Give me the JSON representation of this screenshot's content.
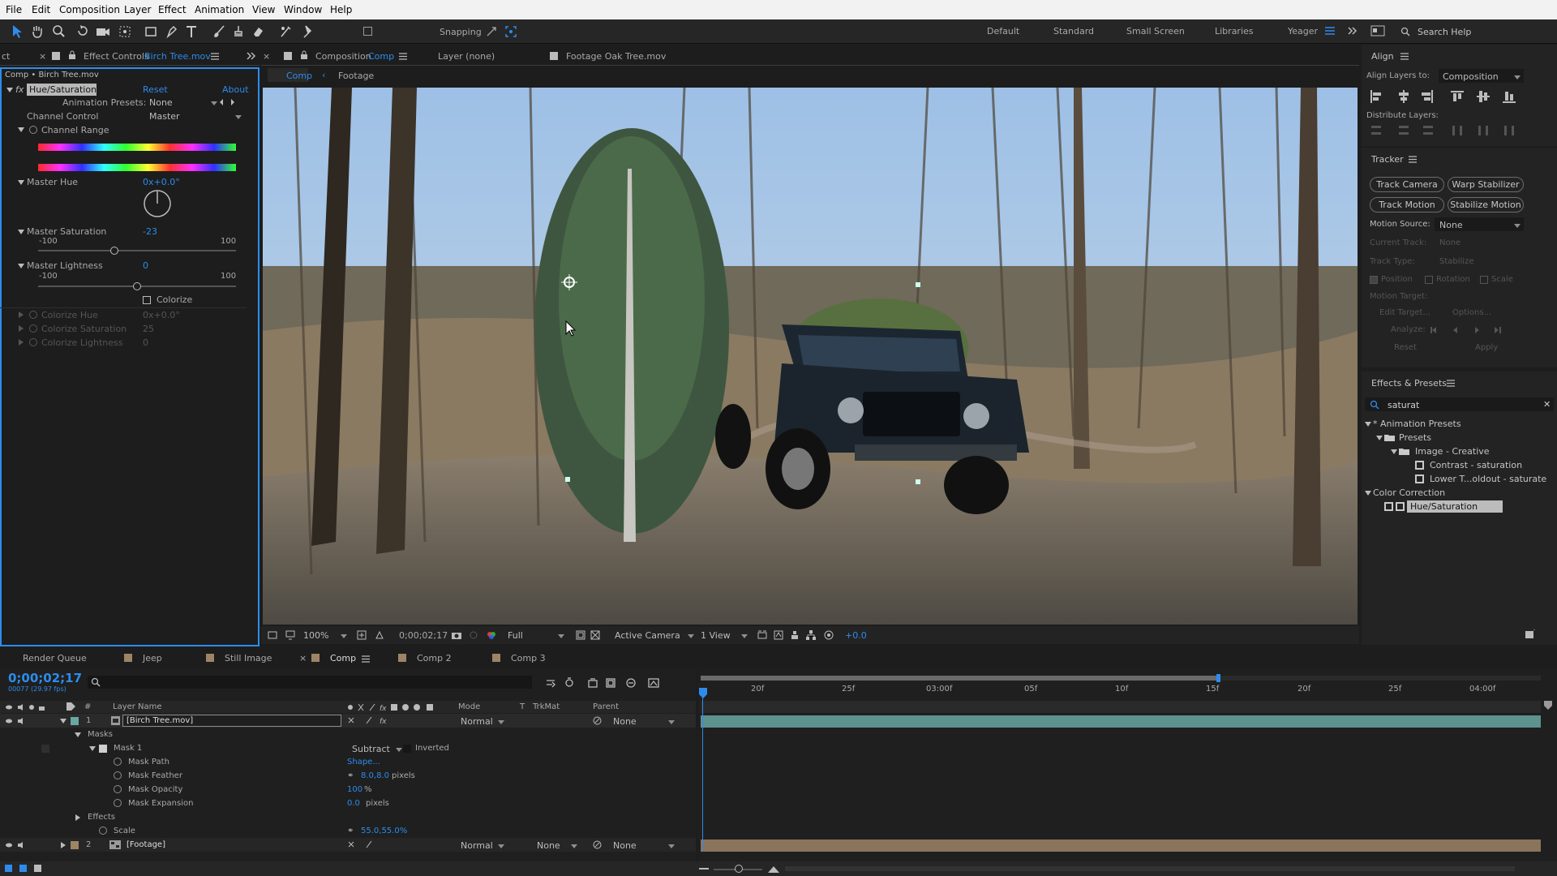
{
  "menu": [
    "File",
    "Edit",
    "Composition",
    "Layer",
    "Effect",
    "Animation",
    "View",
    "Window",
    "Help"
  ],
  "toolbar": {
    "snapping": "Snapping",
    "workspaces": [
      "Default",
      "Standard",
      "Small Screen",
      "Libraries",
      "Yeager"
    ],
    "search_placeholder": "Search Help"
  },
  "effect_controls": {
    "tab_prefix": "Effect Controls",
    "tab_file": "Birch Tree.mov",
    "left_tab": "ct",
    "breadcrumb": "Comp • Birch Tree.mov",
    "effect_name": "Hue/Saturation",
    "reset": "Reset",
    "about": "About",
    "anim_presets_label": "Animation Presets:",
    "anim_presets_value": "None",
    "channel_control_label": "Channel Control",
    "channel_control_value": "Master",
    "channel_range": "Channel Range",
    "master_hue_label": "Master Hue",
    "master_hue_value": "0x+0.0°",
    "master_sat_label": "Master Saturation",
    "master_sat_value": "-23",
    "sat_min": "-100",
    "sat_max": "100",
    "sat_level": 0.385,
    "master_light_label": "Master Lightness",
    "master_light_value": "0",
    "light_min": "-100",
    "light_max": "100",
    "light_level": 0.5,
    "colorize": "Colorize",
    "colorize_hue_label": "Colorize Hue",
    "colorize_hue_value": "0x+0.0°",
    "colorize_sat_label": "Colorize Saturation",
    "colorize_sat_value": "25",
    "colorize_light_label": "Colorize Lightness",
    "colorize_light_value": "0"
  },
  "comp_viewer": {
    "tab_comp_prefix": "Composition",
    "tab_comp_name": "Comp",
    "tab_layer": "Layer (none)",
    "tab_footage": "Footage Oak Tree.mov",
    "subtab_comp": "Comp",
    "subtab_footage": "Footage",
    "zoom": "100%",
    "timecode": "0;00;02;17",
    "resolution": "Full",
    "camera": "Active Camera",
    "views": "1 View",
    "exposure": "+0.0"
  },
  "align": {
    "title": "Align",
    "align_to_label": "Align Layers to:",
    "align_to_value": "Composition",
    "distribute": "Distribute Layers:"
  },
  "tracker": {
    "title": "Tracker",
    "btn_track_camera": "Track Camera",
    "btn_warp": "Warp Stabilizer",
    "btn_track_motion": "Track Motion",
    "btn_stabilize": "Stabilize Motion",
    "motion_source_label": "Motion Source:",
    "motion_source_value": "None",
    "current_track_label": "Current Track:",
    "current_track_value": "None",
    "track_type_label": "Track Type:",
    "track_type_value": "Stabilize",
    "position": "Position",
    "rotation": "Rotation",
    "scale": "Scale",
    "motion_target": "Motion Target:",
    "edit_target": "Edit Target...",
    "options": "Options...",
    "analyze": "Analyze:",
    "reset": "Reset",
    "apply": "Apply"
  },
  "effects_presets": {
    "title": "Effects & Presets",
    "search": "saturat",
    "tree": [
      {
        "label": "* Animation Presets",
        "indent": 0
      },
      {
        "label": "Presets",
        "indent": 1
      },
      {
        "label": "Image - Creative",
        "indent": 2
      },
      {
        "label": "Contrast - saturation",
        "indent": 3
      },
      {
        "label": "Lower T...oldout - saturate",
        "indent": 3
      },
      {
        "label": "Color Correction",
        "indent": 0
      },
      {
        "label": "Hue/Saturation",
        "indent": 1
      }
    ]
  },
  "timeline": {
    "tabs": [
      "Render Queue",
      "Jeep",
      "Still Image",
      "Comp",
      "Comp 2",
      "Comp 3"
    ],
    "timecode": "0;00;02;17",
    "fps": "00077 (29.97 fps)",
    "col_layer_name": "Layer Name",
    "col_mode": "Mode",
    "col_t": "T",
    "col_trkmat": "TrkMat",
    "col_parent": "Parent",
    "ruler": [
      "20f",
      "25f",
      "03:00f",
      "05f",
      "10f",
      "15f",
      "20f",
      "25f",
      "04:00f"
    ],
    "layer1": {
      "num": "1",
      "name": "[Birch Tree.mov]",
      "mode": "Normal",
      "parent": "None"
    },
    "masks": "Masks",
    "mask1": "Mask 1",
    "mask_mode": "Subtract",
    "inverted": "Inverted",
    "mask_path": "Mask Path",
    "mask_path_val": "Shape...",
    "mask_feather": "Mask Feather",
    "mask_feather_val": "8.0,8.0",
    "mask_feather_unit": "pixels",
    "mask_opacity": "Mask Opacity",
    "mask_opacity_val": "100",
    "mask_opacity_unit": "%",
    "mask_expansion": "Mask Expansion",
    "mask_expansion_val": "0.0",
    "mask_expansion_unit": "pixels",
    "effects": "Effects",
    "scale": "Scale",
    "scale_val": "55.0,55.0%",
    "layer2": {
      "num": "2",
      "name": "[Footage]",
      "mode": "Normal",
      "trkmat": "None",
      "parent": "None"
    }
  },
  "colors": {
    "accent": "#2d8ceb",
    "layer1_bar": "#6aa7a3",
    "layer2_bar": "#9e8466"
  }
}
